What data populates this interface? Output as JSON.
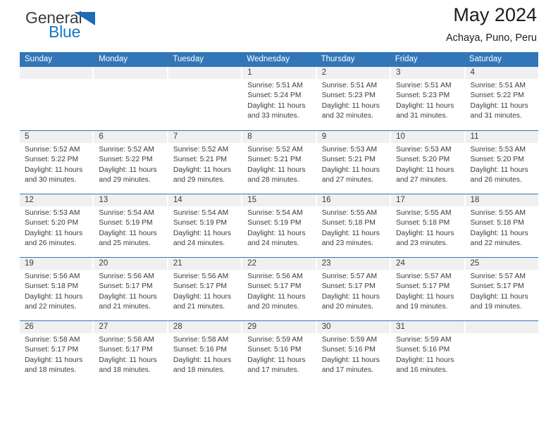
{
  "logo": {
    "word_top": "General",
    "word_bottom": "Blue",
    "triangle_color": "#1f6cb5",
    "blue_text_color": "#1476c6"
  },
  "header": {
    "title": "May 2024",
    "subtitle": "Achaya, Puno, Peru"
  },
  "theme": {
    "header_blue": "#3276b8",
    "day_band_gray": "#f0f0f0",
    "text_color": "#3b3b3b"
  },
  "weekdays": [
    "Sunday",
    "Monday",
    "Tuesday",
    "Wednesday",
    "Thursday",
    "Friday",
    "Saturday"
  ],
  "labels": {
    "sunrise_prefix": "Sunrise:",
    "sunset_prefix": "Sunset:",
    "daylight_prefix": "Daylight:"
  },
  "weeks": [
    [
      {
        "day": "",
        "sunrise": "",
        "sunset": "",
        "daylight_line1": "",
        "daylight_line2": ""
      },
      {
        "day": "",
        "sunrise": "",
        "sunset": "",
        "daylight_line1": "",
        "daylight_line2": ""
      },
      {
        "day": "",
        "sunrise": "",
        "sunset": "",
        "daylight_line1": "",
        "daylight_line2": ""
      },
      {
        "day": "1",
        "sunrise": "Sunrise: 5:51 AM",
        "sunset": "Sunset: 5:24 PM",
        "daylight_line1": "Daylight: 11 hours",
        "daylight_line2": "and 33 minutes."
      },
      {
        "day": "2",
        "sunrise": "Sunrise: 5:51 AM",
        "sunset": "Sunset: 5:23 PM",
        "daylight_line1": "Daylight: 11 hours",
        "daylight_line2": "and 32 minutes."
      },
      {
        "day": "3",
        "sunrise": "Sunrise: 5:51 AM",
        "sunset": "Sunset: 5:23 PM",
        "daylight_line1": "Daylight: 11 hours",
        "daylight_line2": "and 31 minutes."
      },
      {
        "day": "4",
        "sunrise": "Sunrise: 5:51 AM",
        "sunset": "Sunset: 5:22 PM",
        "daylight_line1": "Daylight: 11 hours",
        "daylight_line2": "and 31 minutes."
      }
    ],
    [
      {
        "day": "5",
        "sunrise": "Sunrise: 5:52 AM",
        "sunset": "Sunset: 5:22 PM",
        "daylight_line1": "Daylight: 11 hours",
        "daylight_line2": "and 30 minutes."
      },
      {
        "day": "6",
        "sunrise": "Sunrise: 5:52 AM",
        "sunset": "Sunset: 5:22 PM",
        "daylight_line1": "Daylight: 11 hours",
        "daylight_line2": "and 29 minutes."
      },
      {
        "day": "7",
        "sunrise": "Sunrise: 5:52 AM",
        "sunset": "Sunset: 5:21 PM",
        "daylight_line1": "Daylight: 11 hours",
        "daylight_line2": "and 29 minutes."
      },
      {
        "day": "8",
        "sunrise": "Sunrise: 5:52 AM",
        "sunset": "Sunset: 5:21 PM",
        "daylight_line1": "Daylight: 11 hours",
        "daylight_line2": "and 28 minutes."
      },
      {
        "day": "9",
        "sunrise": "Sunrise: 5:53 AM",
        "sunset": "Sunset: 5:21 PM",
        "daylight_line1": "Daylight: 11 hours",
        "daylight_line2": "and 27 minutes."
      },
      {
        "day": "10",
        "sunrise": "Sunrise: 5:53 AM",
        "sunset": "Sunset: 5:20 PM",
        "daylight_line1": "Daylight: 11 hours",
        "daylight_line2": "and 27 minutes."
      },
      {
        "day": "11",
        "sunrise": "Sunrise: 5:53 AM",
        "sunset": "Sunset: 5:20 PM",
        "daylight_line1": "Daylight: 11 hours",
        "daylight_line2": "and 26 minutes."
      }
    ],
    [
      {
        "day": "12",
        "sunrise": "Sunrise: 5:53 AM",
        "sunset": "Sunset: 5:20 PM",
        "daylight_line1": "Daylight: 11 hours",
        "daylight_line2": "and 26 minutes."
      },
      {
        "day": "13",
        "sunrise": "Sunrise: 5:54 AM",
        "sunset": "Sunset: 5:19 PM",
        "daylight_line1": "Daylight: 11 hours",
        "daylight_line2": "and 25 minutes."
      },
      {
        "day": "14",
        "sunrise": "Sunrise: 5:54 AM",
        "sunset": "Sunset: 5:19 PM",
        "daylight_line1": "Daylight: 11 hours",
        "daylight_line2": "and 24 minutes."
      },
      {
        "day": "15",
        "sunrise": "Sunrise: 5:54 AM",
        "sunset": "Sunset: 5:19 PM",
        "daylight_line1": "Daylight: 11 hours",
        "daylight_line2": "and 24 minutes."
      },
      {
        "day": "16",
        "sunrise": "Sunrise: 5:55 AM",
        "sunset": "Sunset: 5:18 PM",
        "daylight_line1": "Daylight: 11 hours",
        "daylight_line2": "and 23 minutes."
      },
      {
        "day": "17",
        "sunrise": "Sunrise: 5:55 AM",
        "sunset": "Sunset: 5:18 PM",
        "daylight_line1": "Daylight: 11 hours",
        "daylight_line2": "and 23 minutes."
      },
      {
        "day": "18",
        "sunrise": "Sunrise: 5:55 AM",
        "sunset": "Sunset: 5:18 PM",
        "daylight_line1": "Daylight: 11 hours",
        "daylight_line2": "and 22 minutes."
      }
    ],
    [
      {
        "day": "19",
        "sunrise": "Sunrise: 5:56 AM",
        "sunset": "Sunset: 5:18 PM",
        "daylight_line1": "Daylight: 11 hours",
        "daylight_line2": "and 22 minutes."
      },
      {
        "day": "20",
        "sunrise": "Sunrise: 5:56 AM",
        "sunset": "Sunset: 5:17 PM",
        "daylight_line1": "Daylight: 11 hours",
        "daylight_line2": "and 21 minutes."
      },
      {
        "day": "21",
        "sunrise": "Sunrise: 5:56 AM",
        "sunset": "Sunset: 5:17 PM",
        "daylight_line1": "Daylight: 11 hours",
        "daylight_line2": "and 21 minutes."
      },
      {
        "day": "22",
        "sunrise": "Sunrise: 5:56 AM",
        "sunset": "Sunset: 5:17 PM",
        "daylight_line1": "Daylight: 11 hours",
        "daylight_line2": "and 20 minutes."
      },
      {
        "day": "23",
        "sunrise": "Sunrise: 5:57 AM",
        "sunset": "Sunset: 5:17 PM",
        "daylight_line1": "Daylight: 11 hours",
        "daylight_line2": "and 20 minutes."
      },
      {
        "day": "24",
        "sunrise": "Sunrise: 5:57 AM",
        "sunset": "Sunset: 5:17 PM",
        "daylight_line1": "Daylight: 11 hours",
        "daylight_line2": "and 19 minutes."
      },
      {
        "day": "25",
        "sunrise": "Sunrise: 5:57 AM",
        "sunset": "Sunset: 5:17 PM",
        "daylight_line1": "Daylight: 11 hours",
        "daylight_line2": "and 19 minutes."
      }
    ],
    [
      {
        "day": "26",
        "sunrise": "Sunrise: 5:58 AM",
        "sunset": "Sunset: 5:17 PM",
        "daylight_line1": "Daylight: 11 hours",
        "daylight_line2": "and 18 minutes."
      },
      {
        "day": "27",
        "sunrise": "Sunrise: 5:58 AM",
        "sunset": "Sunset: 5:17 PM",
        "daylight_line1": "Daylight: 11 hours",
        "daylight_line2": "and 18 minutes."
      },
      {
        "day": "28",
        "sunrise": "Sunrise: 5:58 AM",
        "sunset": "Sunset: 5:16 PM",
        "daylight_line1": "Daylight: 11 hours",
        "daylight_line2": "and 18 minutes."
      },
      {
        "day": "29",
        "sunrise": "Sunrise: 5:59 AM",
        "sunset": "Sunset: 5:16 PM",
        "daylight_line1": "Daylight: 11 hours",
        "daylight_line2": "and 17 minutes."
      },
      {
        "day": "30",
        "sunrise": "Sunrise: 5:59 AM",
        "sunset": "Sunset: 5:16 PM",
        "daylight_line1": "Daylight: 11 hours",
        "daylight_line2": "and 17 minutes."
      },
      {
        "day": "31",
        "sunrise": "Sunrise: 5:59 AM",
        "sunset": "Sunset: 5:16 PM",
        "daylight_line1": "Daylight: 11 hours",
        "daylight_line2": "and 16 minutes."
      },
      {
        "day": "",
        "sunrise": "",
        "sunset": "",
        "daylight_line1": "",
        "daylight_line2": ""
      }
    ]
  ]
}
